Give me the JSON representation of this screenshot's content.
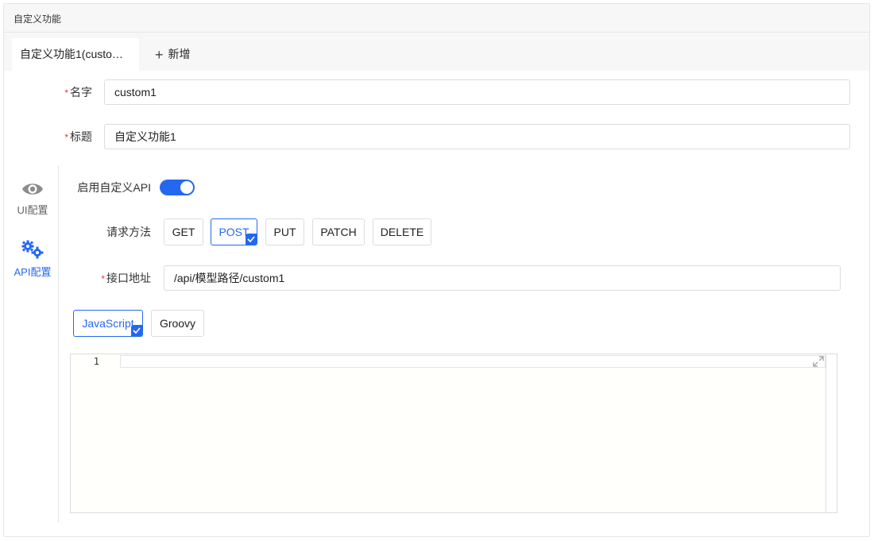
{
  "panel": {
    "title": "自定义功能"
  },
  "tabs": {
    "active_label": "自定义功能1(custom1)",
    "add_label": "新增"
  },
  "form": {
    "name": {
      "label": "名字",
      "value": "custom1"
    },
    "title": {
      "label": "标题",
      "value": "自定义功能1"
    }
  },
  "side_nav": {
    "items": [
      {
        "label": "UI配置",
        "icon": "eye-icon"
      },
      {
        "label": "API配置",
        "icon": "gears-icon",
        "active": true
      }
    ]
  },
  "api": {
    "enable_label": "启用自定义API",
    "enabled": true,
    "method_label": "请求方法",
    "methods": [
      "GET",
      "POST",
      "PUT",
      "PATCH",
      "DELETE"
    ],
    "selected_method": "POST",
    "endpoint_label": "接口地址",
    "endpoint_value": "/api/模型路径/custom1",
    "languages": [
      "JavaScript",
      "Groovy"
    ],
    "selected_language": "JavaScript"
  },
  "editor": {
    "line_numbers": [
      "1"
    ]
  },
  "colors": {
    "accent": "#2468f2",
    "required": "#e4393c",
    "border": "#dcdcdc",
    "header_bg": "#f7f7f8"
  }
}
